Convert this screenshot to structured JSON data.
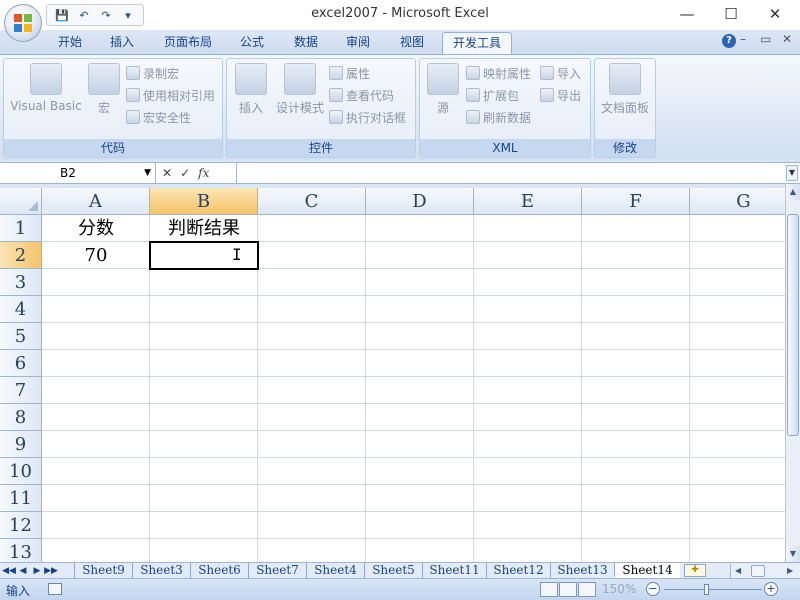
{
  "window": {
    "title": "excel2007 - Microsoft Excel"
  },
  "qat": {
    "save": "💾",
    "undo": "↶",
    "redo": "↷",
    "more": "▾"
  },
  "window_controls": {
    "minimize": "—",
    "maximize": "☐",
    "close": "✕"
  },
  "tabs": [
    {
      "label": "开始"
    },
    {
      "label": "插入"
    },
    {
      "label": "页面布局"
    },
    {
      "label": "公式"
    },
    {
      "label": "数据"
    },
    {
      "label": "审阅"
    },
    {
      "label": "视图"
    },
    {
      "label": "开发工具"
    }
  ],
  "ribbon_right": {
    "help": "?",
    "min": "–",
    "restore": "▭",
    "close": "✕"
  },
  "ribbon": {
    "code": {
      "label": "代码",
      "visual_basic": "Visual Basic",
      "macro": "宏",
      "record_macro": "录制宏",
      "relative_ref": "使用相对引用",
      "macro_security": "宏安全性"
    },
    "controls": {
      "label": "控件",
      "insert": "插入",
      "design_mode": "设计模式",
      "properties": "属性",
      "view_code": "查看代码",
      "run_dialog": "执行对话框"
    },
    "xml": {
      "label": "XML",
      "source": "源",
      "map_props": "映射属性",
      "expansion_pack": "扩展包",
      "refresh_data": "刷新数据",
      "import": "导入",
      "export": "导出"
    },
    "modify": {
      "label": "修改",
      "doc_panel": "文档面板"
    }
  },
  "formula_bar": {
    "name_box": "B2",
    "fx": "fx",
    "cancel": "✕",
    "enter": "✓",
    "formula": ""
  },
  "columns": [
    "A",
    "B",
    "C",
    "D",
    "E",
    "F",
    "G"
  ],
  "rows": [
    "1",
    "2",
    "3",
    "4",
    "5",
    "6",
    "7",
    "8",
    "9",
    "10",
    "11",
    "12",
    "13"
  ],
  "cells": {
    "A1": "分数",
    "B1": "判断结果",
    "A2": "70"
  },
  "selected_cell": "B2",
  "sheets": [
    {
      "name": "Sheet9"
    },
    {
      "name": "Sheet3"
    },
    {
      "name": "Sheet6"
    },
    {
      "name": "Sheet7"
    },
    {
      "name": "Sheet4"
    },
    {
      "name": "Sheet5"
    },
    {
      "name": "Sheet11"
    },
    {
      "name": "Sheet12"
    },
    {
      "name": "Sheet13"
    },
    {
      "name": "Sheet14"
    }
  ],
  "active_sheet": "Sheet14",
  "status": {
    "mode": "输入",
    "zoom": "150%"
  }
}
